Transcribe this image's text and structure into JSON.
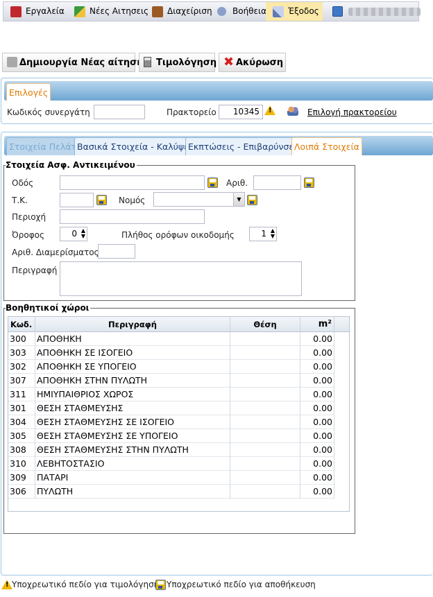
{
  "menu": {
    "tools": "Εργαλεία",
    "new_requests": "Νέες Αιτησεις",
    "management": "Διαχείριση",
    "help": "Βοήθεια",
    "exit": "Έξοδος"
  },
  "toolbar": {
    "create": "Δημιουργία Νέας αίτησης",
    "pricing": "Τιμολόγηση",
    "cancel": "Ακύρωση"
  },
  "options": {
    "tab": "Επιλογές",
    "partner_code_label": "Κωδικός συνεργάτη",
    "partner_code_value": "",
    "agency_label": "Πρακτορείο",
    "agency_value": "10345",
    "select_agency": "Επιλογή πρακτορείου"
  },
  "tabs": [
    {
      "label": "Στοιχεία Πελάτη",
      "state": "dim"
    },
    {
      "label": "Βασικά Στοιχεία - Καλύψεις",
      "state": "normal"
    },
    {
      "label": "Εκπτώσεις - Επιβαρύνσεις",
      "state": "normal"
    },
    {
      "label": "Λοιπά Στοιχεία",
      "state": "active"
    }
  ],
  "insured": {
    "legend": "Στοιχεία Ασφ. Αντικειμένου",
    "street_label": "Οδός",
    "street_value": "",
    "number_label": "Αριθ.",
    "number_value": "",
    "zip_label": "Τ.Κ.",
    "zip_value": "",
    "prefecture_label": "Νομός",
    "prefecture_value": "",
    "area_label": "Περιοχή",
    "area_value": "",
    "floor_label": "Όροφος",
    "floor_value": "0",
    "floors_count_label": "Πλήθος ορόφων οικοδομής",
    "floors_count_value": "1",
    "apartment_label": "Αριθ. Διαμερίσματος",
    "apartment_value": "",
    "description_label": "Περιγραφή",
    "description_value": ""
  },
  "aux": {
    "legend": "Βοηθητικοί χώροι",
    "columns": {
      "code": "Κωδ.",
      "description": "Περιγραφή",
      "position": "Θέση",
      "area": "m²"
    },
    "rows": [
      {
        "code": "300",
        "description": "ΑΠΟΘΗΚΗ",
        "position": "",
        "area": "0.00"
      },
      {
        "code": "303",
        "description": "ΑΠΟΘΗΚΗ ΣΕ ΙΣΟΓΕΙΟ",
        "position": "",
        "area": "0.00"
      },
      {
        "code": "302",
        "description": "ΑΠΟΘΗΚΗ ΣΕ ΥΠΟΓΕΙΟ",
        "position": "",
        "area": "0.00"
      },
      {
        "code": "307",
        "description": "ΑΠΟΘΗΚΗ ΣΤΗΝ ΠΥΛΩΤΗ",
        "position": "",
        "area": "0.00"
      },
      {
        "code": "311",
        "description": "ΗΜΙΥΠΑΙΘΡΙΟΣ ΧΩΡΟΣ",
        "position": "",
        "area": "0.00"
      },
      {
        "code": "301",
        "description": "ΘΕΣΗ ΣΤΑΘΜΕΥΣΗΣ",
        "position": "",
        "area": "0.00"
      },
      {
        "code": "304",
        "description": "ΘΕΣΗ ΣΤΑΘΜΕΥΣΗΣ ΣΕ ΙΣΟΓΕΙΟ",
        "position": "",
        "area": "0.00"
      },
      {
        "code": "305",
        "description": "ΘΕΣΗ ΣΤΑΘΜΕΥΣΗΣ ΣΕ ΥΠΟΓΕΙΟ",
        "position": "",
        "area": "0.00"
      },
      {
        "code": "308",
        "description": "ΘΕΣΗ ΣΤΑΘΜΕΥΣΗΣ ΣΤΗΝ ΠΥΛΩΤΗ",
        "position": "",
        "area": "0.00"
      },
      {
        "code": "310",
        "description": "ΛΕΒΗΤΟΣΤΑΣΙΟ",
        "position": "",
        "area": "0.00"
      },
      {
        "code": "309",
        "description": "ΠΑΤΑΡΙ",
        "position": "",
        "area": "0.00"
      },
      {
        "code": "306",
        "description": "ΠΥΛΩΤΗ",
        "position": "",
        "area": "0.00"
      }
    ]
  },
  "footer": {
    "pricing_required": "Υποχρεωτικό πεδίο για τιμολόγηση",
    "save_required": "Υποχρεωτικό πεδίο για αποθήκευση"
  },
  "colors": {
    "accent": "#e07a00",
    "tab_bar": "#6ea6d3",
    "warning": "#f2b705"
  }
}
